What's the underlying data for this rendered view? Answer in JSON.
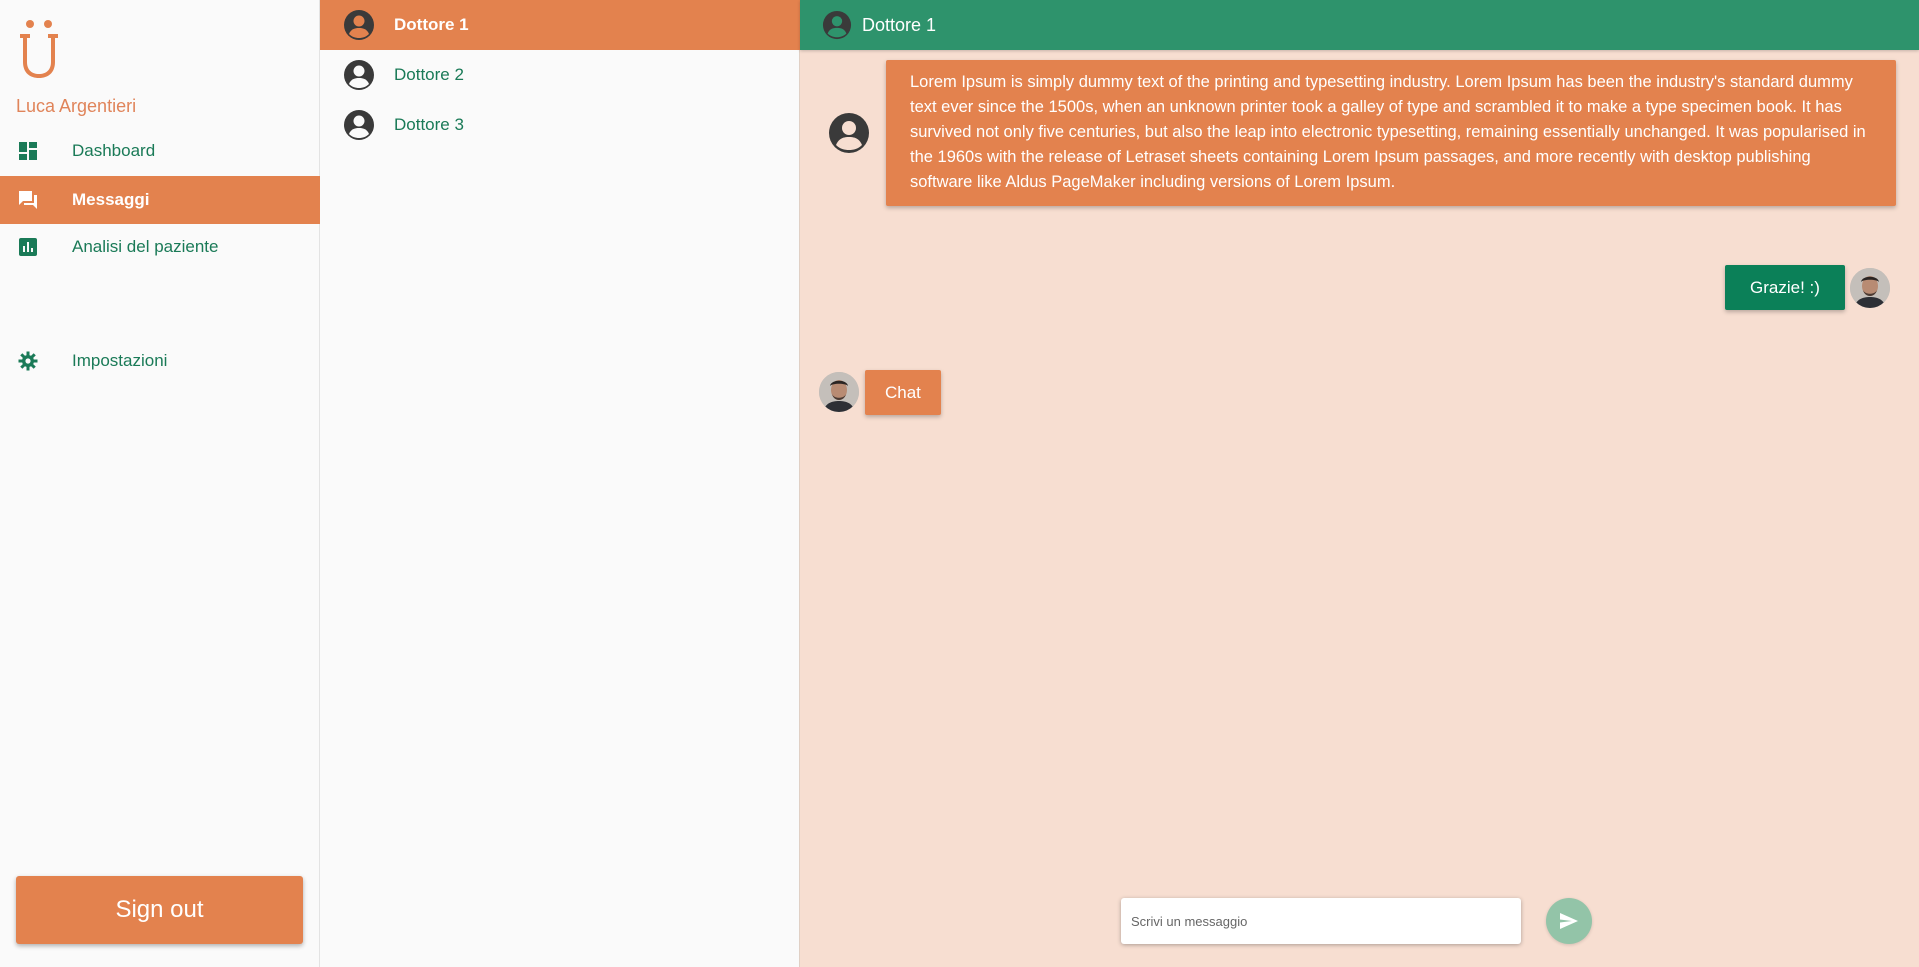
{
  "theme": {
    "accent_orange": "#e3824e",
    "accent_green": "#2e936c",
    "dark_green": "#0b8058",
    "chat_bg": "#f7ded1"
  },
  "sidebar": {
    "logo_icon": "u-umlaut-logo",
    "user_name": "Luca Argentieri",
    "items": [
      {
        "label": "Dashboard",
        "icon": "dashboard-icon",
        "active": false
      },
      {
        "label": "Messaggi",
        "icon": "chat-icon",
        "active": true
      },
      {
        "label": "Analisi del paziente",
        "icon": "analytics-icon",
        "active": false
      },
      {
        "label": "Impostazioni",
        "icon": "gear-icon",
        "active": false
      }
    ],
    "signout_label": "Sign out"
  },
  "contacts": [
    {
      "name": "Dottore 1",
      "active": true
    },
    {
      "name": "Dottore 2",
      "active": false
    },
    {
      "name": "Dottore 3",
      "active": false
    }
  ],
  "chat": {
    "header_name": "Dottore 1",
    "messages": [
      {
        "from": "doctor",
        "text": "Lorem Ipsum is simply dummy text of the printing and typesetting industry. Lorem Ipsum has been the industry's standard dummy text ever since the 1500s, when an unknown printer took a galley of type and scrambled it to make a type specimen book. It has survived not only five centuries, but also the leap into electronic typesetting, remaining essentially unchanged. It was popularised in the 1960s with the release of Letraset sheets containing Lorem Ipsum passages, and more recently with desktop publishing software like Aldus PageMaker including versions of Lorem Ipsum."
      },
      {
        "from": "user",
        "text": "Grazie! :)"
      },
      {
        "from": "user-left",
        "text": "Chat"
      }
    ],
    "composer_placeholder": "Scrivi un messaggio",
    "send_icon": "send-icon"
  }
}
